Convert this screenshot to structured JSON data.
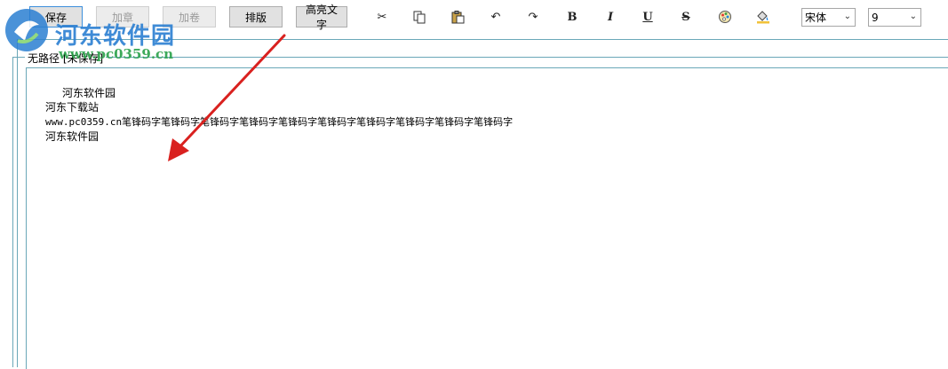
{
  "toolbar": {
    "save_label": "保存",
    "add_chapter_label": "加章",
    "add_volume_label": "加卷",
    "layout_label": "排版",
    "highlight_label": "高亮文字",
    "icons": [
      {
        "name": "cut-icon",
        "glyph": "✂"
      },
      {
        "name": "copy-icon",
        "glyph": "⧉"
      },
      {
        "name": "paste-icon",
        "glyph": "📋"
      },
      {
        "name": "undo-icon",
        "glyph": "↶"
      },
      {
        "name": "redo-icon",
        "glyph": "↷"
      },
      {
        "name": "bold-icon",
        "glyph": "B"
      },
      {
        "name": "italic-icon",
        "glyph": "I"
      },
      {
        "name": "underline-icon",
        "glyph": "U"
      },
      {
        "name": "strikethrough-icon",
        "glyph": "S"
      },
      {
        "name": "color-palette-icon",
        "glyph": "🎨"
      },
      {
        "name": "fill-color-icon",
        "glyph": "🪣"
      }
    ],
    "font_select_value": "宋体",
    "size_select_value": "9"
  },
  "watermark": {
    "title": "河东软件园",
    "url": "www.pc0359.cn"
  },
  "document": {
    "path_label": "无路径 [未保存]",
    "lines": [
      "河东软件园",
      "河东下载站",
      "www.pc0359.cn笔锋码字笔锋码字笔锋码字笔锋码字笔锋码字笔锋码字笔锋码字笔锋码字笔锋码字笔锋码字",
      "河东软件园"
    ]
  },
  "colors": {
    "accent": "#3c8fdc",
    "frame": "#6aa7b8",
    "arrow": "#d9211f"
  }
}
